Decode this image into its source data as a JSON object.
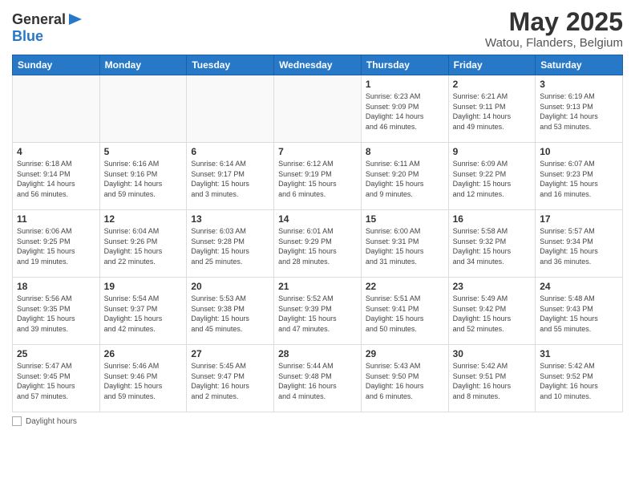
{
  "header": {
    "logo_general": "General",
    "logo_blue": "Blue",
    "month": "May 2025",
    "location": "Watou, Flanders, Belgium"
  },
  "weekdays": [
    "Sunday",
    "Monday",
    "Tuesday",
    "Wednesday",
    "Thursday",
    "Friday",
    "Saturday"
  ],
  "weeks": [
    [
      {
        "day": "",
        "info": ""
      },
      {
        "day": "",
        "info": ""
      },
      {
        "day": "",
        "info": ""
      },
      {
        "day": "",
        "info": ""
      },
      {
        "day": "1",
        "info": "Sunrise: 6:23 AM\nSunset: 9:09 PM\nDaylight: 14 hours\nand 46 minutes."
      },
      {
        "day": "2",
        "info": "Sunrise: 6:21 AM\nSunset: 9:11 PM\nDaylight: 14 hours\nand 49 minutes."
      },
      {
        "day": "3",
        "info": "Sunrise: 6:19 AM\nSunset: 9:13 PM\nDaylight: 14 hours\nand 53 minutes."
      }
    ],
    [
      {
        "day": "4",
        "info": "Sunrise: 6:18 AM\nSunset: 9:14 PM\nDaylight: 14 hours\nand 56 minutes."
      },
      {
        "day": "5",
        "info": "Sunrise: 6:16 AM\nSunset: 9:16 PM\nDaylight: 14 hours\nand 59 minutes."
      },
      {
        "day": "6",
        "info": "Sunrise: 6:14 AM\nSunset: 9:17 PM\nDaylight: 15 hours\nand 3 minutes."
      },
      {
        "day": "7",
        "info": "Sunrise: 6:12 AM\nSunset: 9:19 PM\nDaylight: 15 hours\nand 6 minutes."
      },
      {
        "day": "8",
        "info": "Sunrise: 6:11 AM\nSunset: 9:20 PM\nDaylight: 15 hours\nand 9 minutes."
      },
      {
        "day": "9",
        "info": "Sunrise: 6:09 AM\nSunset: 9:22 PM\nDaylight: 15 hours\nand 12 minutes."
      },
      {
        "day": "10",
        "info": "Sunrise: 6:07 AM\nSunset: 9:23 PM\nDaylight: 15 hours\nand 16 minutes."
      }
    ],
    [
      {
        "day": "11",
        "info": "Sunrise: 6:06 AM\nSunset: 9:25 PM\nDaylight: 15 hours\nand 19 minutes."
      },
      {
        "day": "12",
        "info": "Sunrise: 6:04 AM\nSunset: 9:26 PM\nDaylight: 15 hours\nand 22 minutes."
      },
      {
        "day": "13",
        "info": "Sunrise: 6:03 AM\nSunset: 9:28 PM\nDaylight: 15 hours\nand 25 minutes."
      },
      {
        "day": "14",
        "info": "Sunrise: 6:01 AM\nSunset: 9:29 PM\nDaylight: 15 hours\nand 28 minutes."
      },
      {
        "day": "15",
        "info": "Sunrise: 6:00 AM\nSunset: 9:31 PM\nDaylight: 15 hours\nand 31 minutes."
      },
      {
        "day": "16",
        "info": "Sunrise: 5:58 AM\nSunset: 9:32 PM\nDaylight: 15 hours\nand 34 minutes."
      },
      {
        "day": "17",
        "info": "Sunrise: 5:57 AM\nSunset: 9:34 PM\nDaylight: 15 hours\nand 36 minutes."
      }
    ],
    [
      {
        "day": "18",
        "info": "Sunrise: 5:56 AM\nSunset: 9:35 PM\nDaylight: 15 hours\nand 39 minutes."
      },
      {
        "day": "19",
        "info": "Sunrise: 5:54 AM\nSunset: 9:37 PM\nDaylight: 15 hours\nand 42 minutes."
      },
      {
        "day": "20",
        "info": "Sunrise: 5:53 AM\nSunset: 9:38 PM\nDaylight: 15 hours\nand 45 minutes."
      },
      {
        "day": "21",
        "info": "Sunrise: 5:52 AM\nSunset: 9:39 PM\nDaylight: 15 hours\nand 47 minutes."
      },
      {
        "day": "22",
        "info": "Sunrise: 5:51 AM\nSunset: 9:41 PM\nDaylight: 15 hours\nand 50 minutes."
      },
      {
        "day": "23",
        "info": "Sunrise: 5:49 AM\nSunset: 9:42 PM\nDaylight: 15 hours\nand 52 minutes."
      },
      {
        "day": "24",
        "info": "Sunrise: 5:48 AM\nSunset: 9:43 PM\nDaylight: 15 hours\nand 55 minutes."
      }
    ],
    [
      {
        "day": "25",
        "info": "Sunrise: 5:47 AM\nSunset: 9:45 PM\nDaylight: 15 hours\nand 57 minutes."
      },
      {
        "day": "26",
        "info": "Sunrise: 5:46 AM\nSunset: 9:46 PM\nDaylight: 15 hours\nand 59 minutes."
      },
      {
        "day": "27",
        "info": "Sunrise: 5:45 AM\nSunset: 9:47 PM\nDaylight: 16 hours\nand 2 minutes."
      },
      {
        "day": "28",
        "info": "Sunrise: 5:44 AM\nSunset: 9:48 PM\nDaylight: 16 hours\nand 4 minutes."
      },
      {
        "day": "29",
        "info": "Sunrise: 5:43 AM\nSunset: 9:50 PM\nDaylight: 16 hours\nand 6 minutes."
      },
      {
        "day": "30",
        "info": "Sunrise: 5:42 AM\nSunset: 9:51 PM\nDaylight: 16 hours\nand 8 minutes."
      },
      {
        "day": "31",
        "info": "Sunrise: 5:42 AM\nSunset: 9:52 PM\nDaylight: 16 hours\nand 10 minutes."
      }
    ]
  ],
  "footer": {
    "daylight_label": "Daylight hours"
  }
}
